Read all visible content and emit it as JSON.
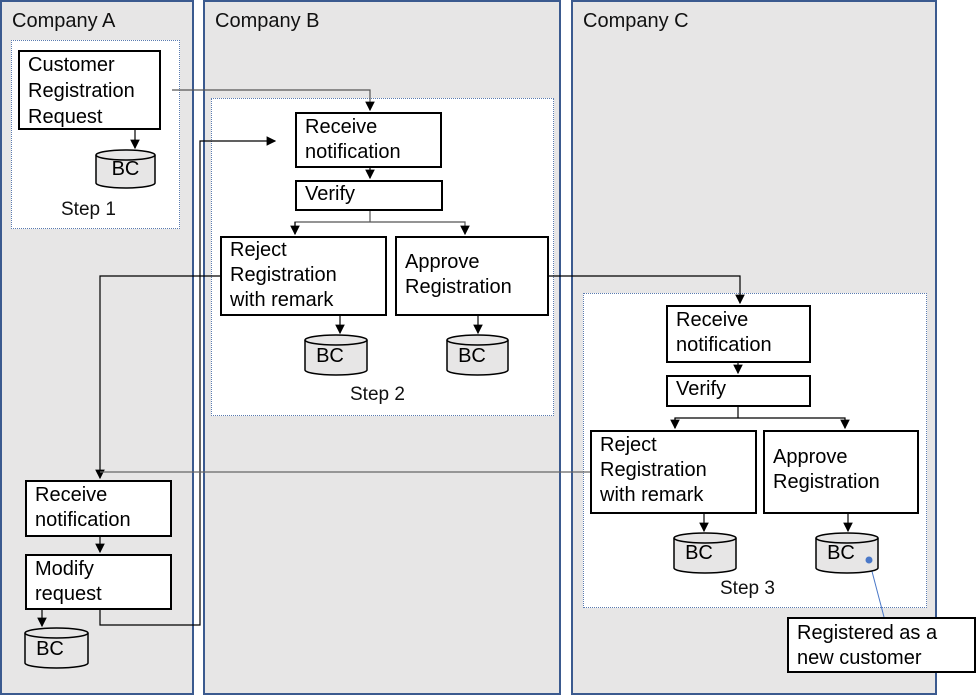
{
  "lanes": [
    {
      "title": "Company A"
    },
    {
      "title": "Company B"
    },
    {
      "title": "Company C"
    }
  ],
  "company_a": {
    "request": "Customer\nRegistration\nRequest",
    "bc": "BC",
    "step": "Step 1",
    "receive": "Receive\nnotification",
    "modify": "Modify\nrequest",
    "bc2": "BC"
  },
  "company_b": {
    "receive": "Receive\nnotification",
    "verify": "Verify",
    "reject": "Reject\nRegistration\nwith remark",
    "approve": "Approve\nRegistration",
    "bc_reject": "BC",
    "bc_approve": "BC",
    "step": "Step 2"
  },
  "company_c": {
    "receive": "Receive\nnotification",
    "verify": "Verify",
    "reject": "Reject\nRegistration\nwith remark",
    "approve": "Approve\nRegistration",
    "bc_reject": "BC",
    "bc_approve": "BC",
    "step": "Step 3"
  },
  "callout": "Registered as a\nnew customer",
  "colors": {
    "lane_fill": "#e7e6e6",
    "lane_border": "#3b5a8f",
    "callout_line": "#4a78c8"
  }
}
